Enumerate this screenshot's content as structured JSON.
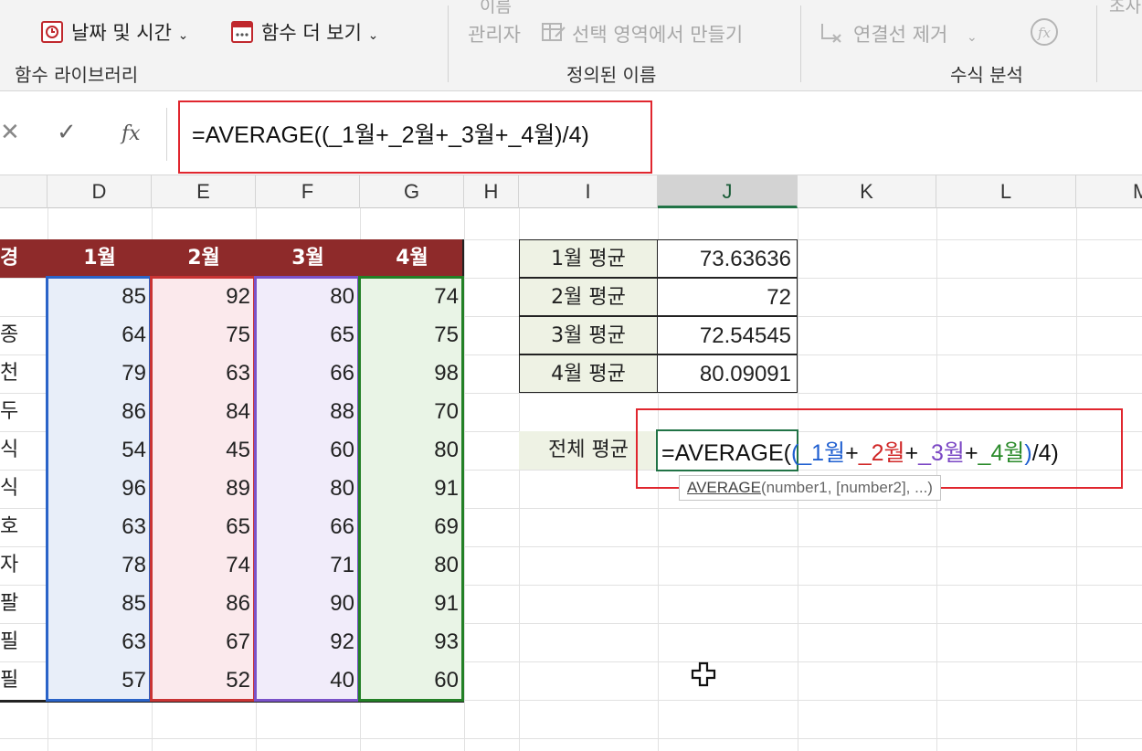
{
  "ribbon": {
    "date_time_label": "날짜 및 시간",
    "more_functions_label": "함수 더 보기",
    "name_label_top": "이름",
    "name_manager_label": "관리자",
    "create_from_selection_label": "선택 영역에서 만들기",
    "remove_arrows_label": "연결선 제거",
    "group_function_library": "함수 라이브러리",
    "group_defined_names": "정의된 이름",
    "group_formula_auditing": "수식 분석",
    "cut_text": "조사"
  },
  "formula_bar": {
    "cancel_glyph": "✕",
    "enter_glyph": "✓",
    "fx_glyph": "fx",
    "formula": "=AVERAGE((_1월+_2월+_3월+_4월)/4)"
  },
  "columns": [
    "D",
    "E",
    "F",
    "G",
    "H",
    "I",
    "J",
    "K",
    "L",
    "M"
  ],
  "table": {
    "name_header_fragment": "경",
    "month_headers": [
      "1월",
      "2월",
      "3월",
      "4월"
    ],
    "rows": [
      {
        "name": "",
        "values": [
          85,
          92,
          80,
          74
        ]
      },
      {
        "name": "종",
        "values": [
          64,
          75,
          65,
          75
        ]
      },
      {
        "name": "천",
        "values": [
          79,
          63,
          66,
          98
        ]
      },
      {
        "name": "두",
        "values": [
          86,
          84,
          88,
          70
        ]
      },
      {
        "name": "식",
        "values": [
          54,
          45,
          60,
          80
        ]
      },
      {
        "name": "식",
        "values": [
          96,
          89,
          80,
          91
        ]
      },
      {
        "name": "호",
        "values": [
          63,
          65,
          66,
          69
        ]
      },
      {
        "name": "자",
        "values": [
          78,
          74,
          71,
          80
        ]
      },
      {
        "name": "팔",
        "values": [
          85,
          86,
          90,
          91
        ]
      },
      {
        "name": "필",
        "values": [
          63,
          67,
          92,
          93
        ]
      },
      {
        "name": "필",
        "values": [
          57,
          52,
          40,
          60
        ]
      }
    ]
  },
  "summary": [
    {
      "label": "1월 평균",
      "value": "73.63636"
    },
    {
      "label": "2월 평균",
      "value": "72"
    },
    {
      "label": "3월 평균",
      "value": "72.54545"
    },
    {
      "label": "4월 평균",
      "value": "80.09091"
    }
  ],
  "overall": {
    "label": "전체 평균",
    "formula_parts": [
      {
        "text": "=AVERAGE(",
        "color": "#111111"
      },
      {
        "text": "(",
        "color": "#1f5fd0"
      },
      {
        "text": "_1월",
        "color": "#1f5fd0"
      },
      {
        "text": "+",
        "color": "#111111"
      },
      {
        "text": "_2월",
        "color": "#d02727"
      },
      {
        "text": "+",
        "color": "#111111"
      },
      {
        "text": "_3월",
        "color": "#7a46c4"
      },
      {
        "text": "+",
        "color": "#111111"
      },
      {
        "text": "_4월",
        "color": "#2a8a2a"
      },
      {
        "text": ")",
        "color": "#1f5fd0"
      },
      {
        "text": "/4)",
        "color": "#111111"
      }
    ]
  },
  "tooltip": {
    "func": "AVERAGE",
    "args": "(number1, [number2], ...)"
  },
  "colors": {
    "header_fill": "#8e2a2a",
    "col1_border": "#2a63c8",
    "col2_border": "#c93434",
    "col3_border": "#7a52c9",
    "col4_border": "#238026",
    "col1_fill": "#e8eef9",
    "col2_fill": "#fbe9ec",
    "col3_fill": "#f1ecfa",
    "col4_fill": "#e9f4e6",
    "highlight_box": "#e0262e",
    "active_cell": "#217346"
  }
}
